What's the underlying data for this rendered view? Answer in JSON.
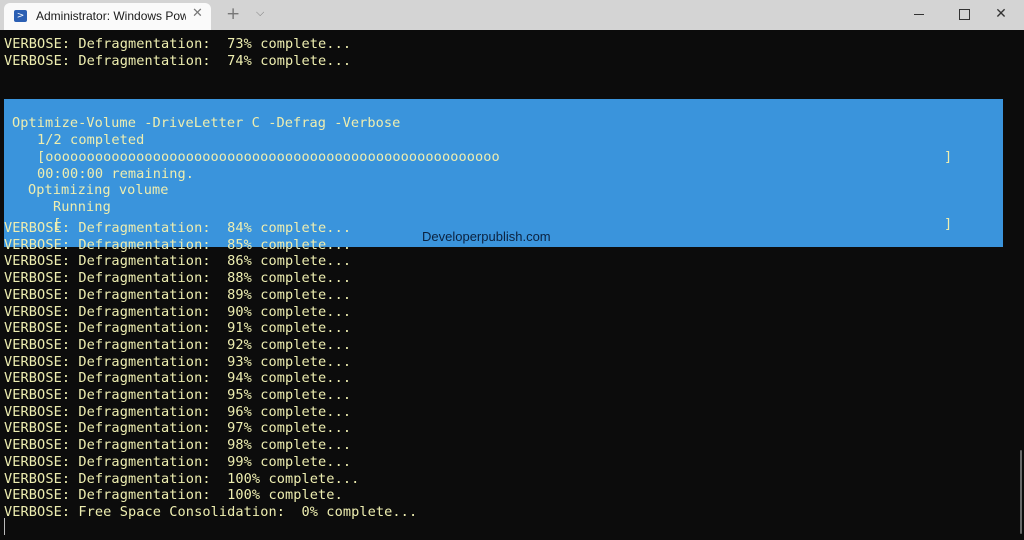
{
  "window": {
    "tab_title": "Administrator: Windows PowerShell",
    "tab_icon": "powershell-icon",
    "controls": {
      "minimize": "minimize-icon",
      "maximize": "maximize-icon",
      "close": "close-icon"
    },
    "new_tab_symbol": "+",
    "dropdown_symbol": "⌵",
    "close_symbol": "✕"
  },
  "console": {
    "lines_before": [
      "VERBOSE: Defragmentation:  73% complete...",
      "VERBOSE: Defragmentation:  74% complete..."
    ],
    "progress": {
      "command": "Optimize-Volume -DriveLetter C -Defrag -Verbose",
      "status1": "1/2 completed",
      "bar1": "[ooooooooooooooooooooooooooooooooooooooooooooooooooooooo",
      "bar1_end": "]",
      "remaining": "00:00:00 remaining.",
      "activity": "Optimizing volume",
      "status2": "Running",
      "bar2": "[",
      "bar2_end": "]",
      "accent_color": "#3a94dc"
    },
    "lines_after": [
      "VERBOSE: Defragmentation:  84% complete...",
      "VERBOSE: Defragmentation:  85% complete...",
      "VERBOSE: Defragmentation:  86% complete...",
      "VERBOSE: Defragmentation:  88% complete...",
      "VERBOSE: Defragmentation:  89% complete...",
      "VERBOSE: Defragmentation:  90% complete...",
      "VERBOSE: Defragmentation:  91% complete...",
      "VERBOSE: Defragmentation:  92% complete...",
      "VERBOSE: Defragmentation:  93% complete...",
      "VERBOSE: Defragmentation:  94% complete...",
      "VERBOSE: Defragmentation:  95% complete...",
      "VERBOSE: Defragmentation:  96% complete...",
      "VERBOSE: Defragmentation:  97% complete...",
      "VERBOSE: Defragmentation:  98% complete...",
      "VERBOSE: Defragmentation:  99% complete...",
      "VERBOSE: Defragmentation:  100% complete...",
      "VERBOSE: Defragmentation:  100% complete.",
      "VERBOSE: Free Space Consolidation:  0% complete..."
    ]
  },
  "watermark": "Developerpublish.com"
}
